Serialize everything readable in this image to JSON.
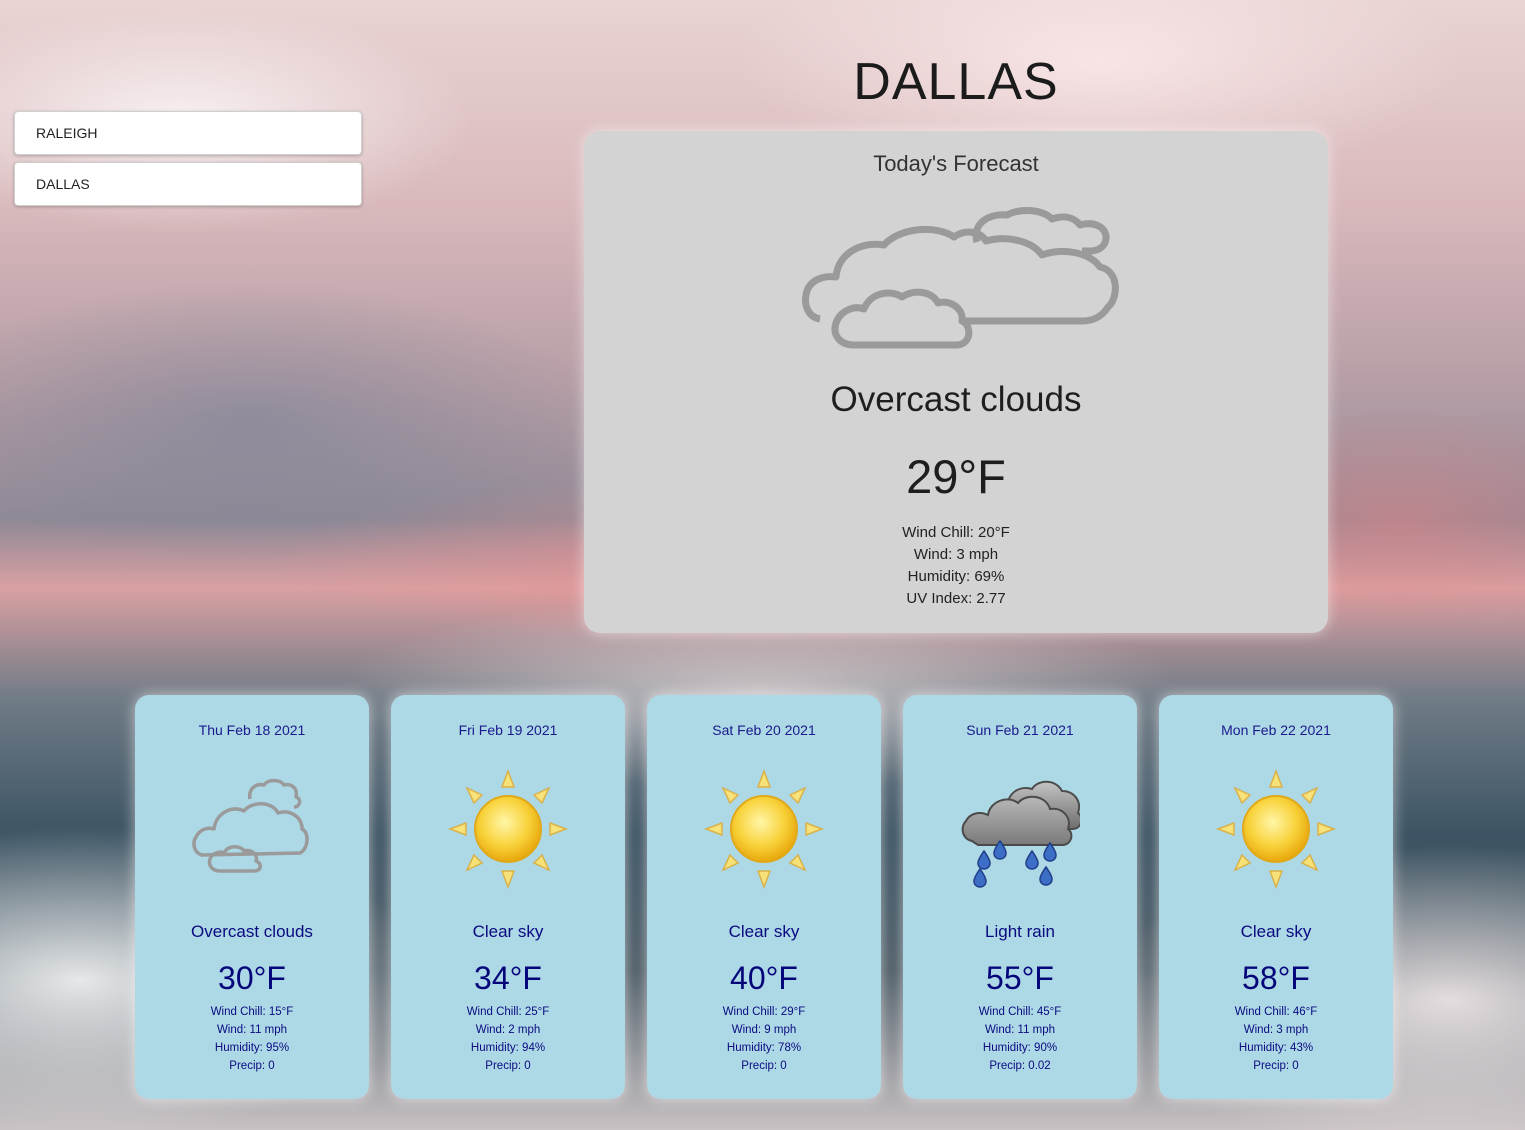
{
  "sidebar": {
    "cities": [
      {
        "label": "RALEIGH"
      },
      {
        "label": "DALLAS"
      }
    ]
  },
  "main": {
    "city": "DALLAS",
    "today": {
      "heading": "Today's Forecast",
      "icon": "overcast-clouds-icon",
      "description": "Overcast clouds",
      "temperature": "29°F",
      "details": {
        "wind_chill": "Wind Chill: 20°F",
        "wind": "Wind: 3 mph",
        "humidity": "Humidity: 69%",
        "uv_index": "UV Index: 2.77"
      }
    },
    "forecast": [
      {
        "date": "Thu Feb 18 2021",
        "icon": "overcast-clouds-icon",
        "description": "Overcast clouds",
        "temperature": "30°F",
        "wind_chill": "Wind Chill: 15°F",
        "wind": "Wind: 11 mph",
        "humidity": "Humidity: 95%",
        "precip": "Precip: 0"
      },
      {
        "date": "Fri Feb 19 2021",
        "icon": "sun-icon",
        "description": "Clear sky",
        "temperature": "34°F",
        "wind_chill": "Wind Chill: 25°F",
        "wind": "Wind: 2 mph",
        "humidity": "Humidity: 94%",
        "precip": "Precip: 0"
      },
      {
        "date": "Sat Feb 20 2021",
        "icon": "sun-icon",
        "description": "Clear sky",
        "temperature": "40°F",
        "wind_chill": "Wind Chill: 29°F",
        "wind": "Wind: 9 mph",
        "humidity": "Humidity: 78%",
        "precip": "Precip: 0"
      },
      {
        "date": "Sun Feb 21 2021",
        "icon": "rain-cloud-icon",
        "description": "Light rain",
        "temperature": "55°F",
        "wind_chill": "Wind Chill: 45°F",
        "wind": "Wind: 11 mph",
        "humidity": "Humidity: 90%",
        "precip": "Precip: 0.02"
      },
      {
        "date": "Mon Feb 22 2021",
        "icon": "sun-icon",
        "description": "Clear sky",
        "temperature": "58°F",
        "wind_chill": "Wind Chill: 46°F",
        "wind": "Wind: 3 mph",
        "humidity": "Humidity: 43%",
        "precip": "Precip: 0"
      }
    ]
  },
  "colors": {
    "today_card_bg": "#d3d3d3",
    "forecast_card_bg": "#add8e6",
    "forecast_text": "#00008b"
  }
}
